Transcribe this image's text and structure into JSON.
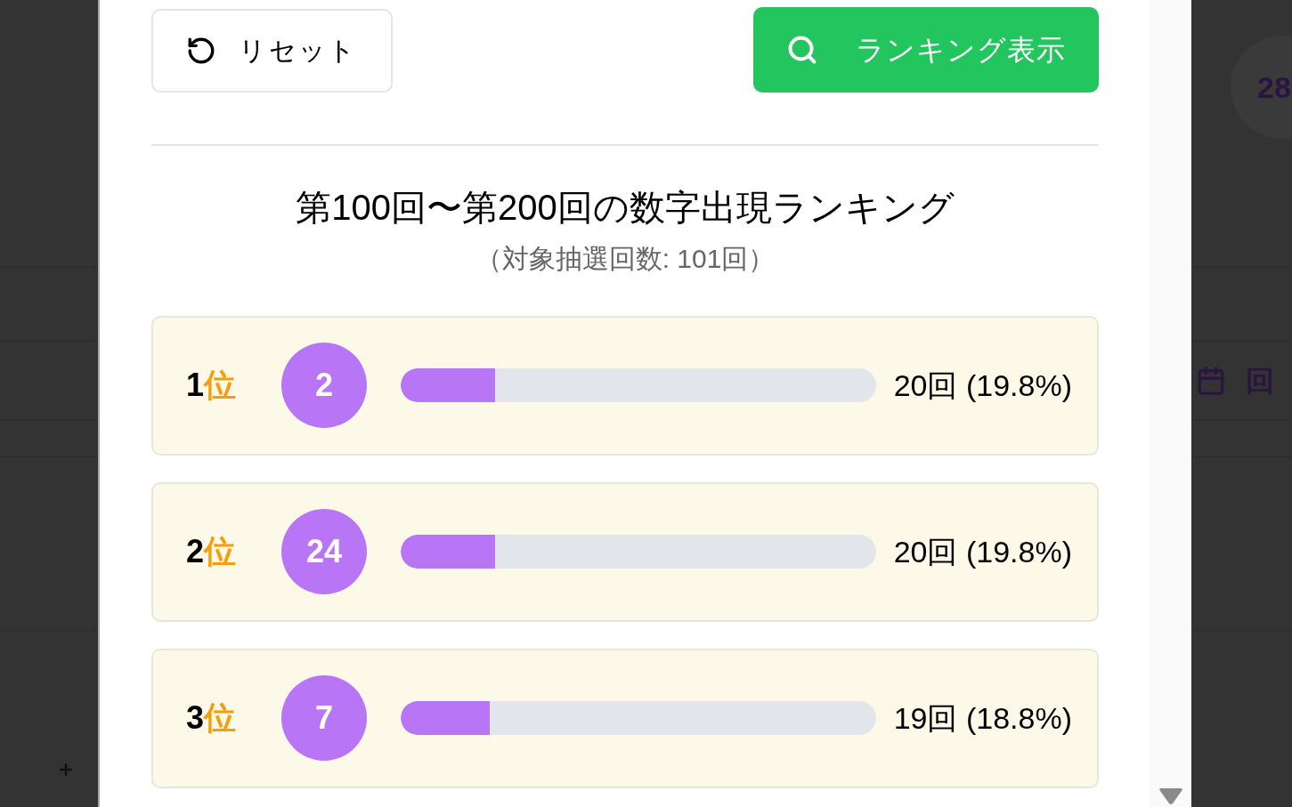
{
  "background": {
    "ball_number": "28",
    "row_label": "回"
  },
  "dialog": {
    "buttons": [
      {
        "kind": "reset",
        "label": "リセット"
      },
      {
        "kind": "search",
        "label": "ランキング表示"
      }
    ],
    "title": "第100回〜第200回の数字出現ランキング",
    "subtitle": "（対象抽選回数: 101回）",
    "ranking": [
      {
        "rank": "1",
        "rank_unit": "位",
        "number": "2",
        "level": 0.198,
        "count": "20回 (19.8%)"
      },
      {
        "rank": "2",
        "rank_unit": "位",
        "number": "24",
        "level": 0.198,
        "count": "20回 (19.8%)"
      },
      {
        "rank": "3",
        "rank_unit": "位",
        "number": "7",
        "level": 0.188,
        "count": "19回 (18.8%)"
      }
    ]
  }
}
